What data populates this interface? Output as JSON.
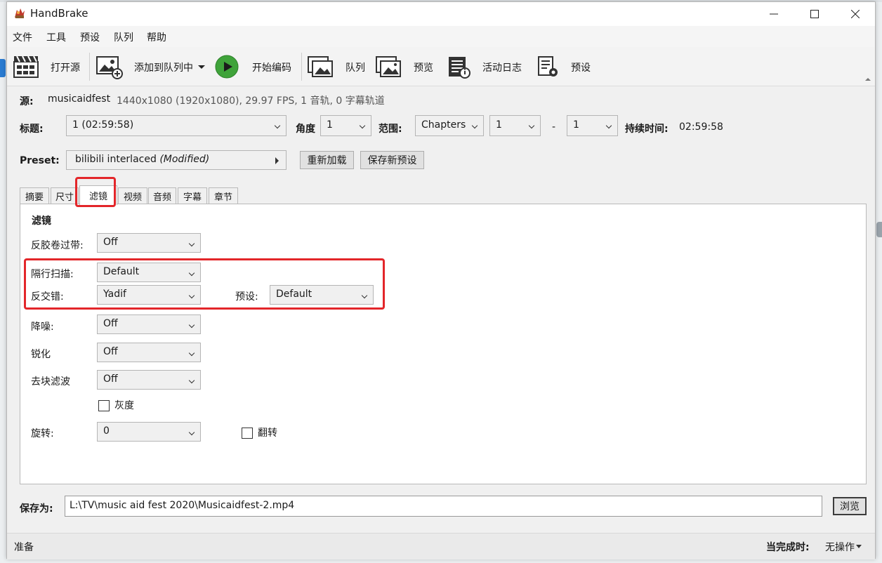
{
  "window": {
    "title": "HandBrake"
  },
  "menu": [
    "文件",
    "工具",
    "预设",
    "队列",
    "帮助"
  ],
  "toolbar": {
    "open_source": "打开源",
    "add_to_queue": "添加到队列中",
    "start_encode": "开始编码",
    "queue": "队列",
    "preview": "预览",
    "activity_log": "活动日志",
    "presets": "预设"
  },
  "source": {
    "label": "源:",
    "name": "musicaidfest",
    "info": "1440x1080 (1920x1080), 29.97 FPS, 1 音轨, 0 字幕轨道"
  },
  "title_row": {
    "title_label": "标题:",
    "title_value": "1  (02:59:58)",
    "angle_label": "角度",
    "angle_value": "1",
    "range_label": "范围:",
    "range_type": "Chapters",
    "range_start": "1",
    "range_dash": "-",
    "range_end": "1",
    "duration_label": "持续时间:",
    "duration_value": "02:59:58"
  },
  "preset": {
    "label": "Preset:",
    "name": "bilibili interlaced",
    "modified": "(Modified)",
    "reload_button": "重新加载",
    "save_new_button": "保存新预设"
  },
  "tabs": [
    "摘要",
    "尺寸",
    "滤镜",
    "视频",
    "音频",
    "字幕",
    "章节"
  ],
  "active_tab": "滤镜",
  "filters": {
    "heading": "滤镜",
    "detelecine": {
      "label": "反胶卷过带:",
      "value": "Off"
    },
    "interlace_detection": {
      "label": "隔行扫描:",
      "value": "Default"
    },
    "deinterlace": {
      "label": "反交错:",
      "value": "Yadif",
      "preset_label": "预设:",
      "preset_value": "Default"
    },
    "denoise": {
      "label": "降噪:",
      "value": "Off"
    },
    "sharpen": {
      "label": "锐化",
      "value": "Off"
    },
    "deblock": {
      "label": "去块滤波",
      "value": "Off"
    },
    "grayscale": {
      "label": "灰度",
      "checked": false
    },
    "rotate": {
      "label": "旋转:",
      "value": "0"
    },
    "flip": {
      "label": "翻转",
      "checked": false
    }
  },
  "save": {
    "label": "保存为:",
    "path": "L:\\TV\\music aid fest 2020\\Musicaidfest-2.mp4",
    "browse_button": "浏览"
  },
  "status": {
    "text": "准备",
    "when_done_label": "当完成时:",
    "when_done_value": "无操作"
  },
  "colors": {
    "highlight": "#e3262a",
    "play_green": "#3fa33a"
  }
}
